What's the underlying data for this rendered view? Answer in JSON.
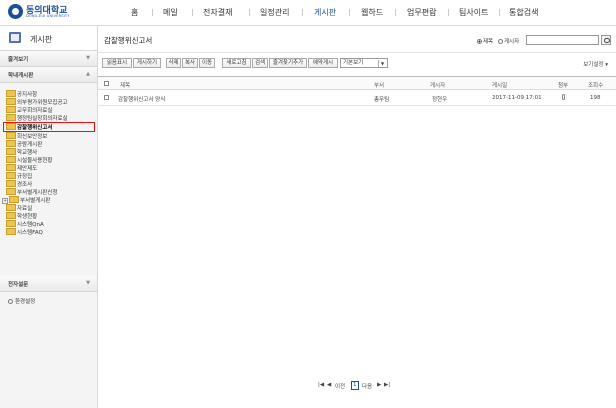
{
  "header": {
    "logo_name": "동의대학교",
    "logo_sub": "DONG-EUI UNIVERSITY",
    "nav": [
      "홈",
      "메일",
      "전자결재",
      "일정관리",
      "게시판",
      "웹하드",
      "업무편람",
      "팀사이트",
      "통합검색"
    ],
    "active_nav": "게시판"
  },
  "sidebar": {
    "title": "게시판",
    "sections": {
      "favorites": "즐겨보기",
      "campus_board": "학내게시판",
      "survey": "전자설문"
    },
    "tree": [
      {
        "label": "공지사항",
        "plus": false
      },
      {
        "label": "외부평가위원모집공고",
        "plus": false
      },
      {
        "label": "교무회의자료실",
        "plus": false
      },
      {
        "label": "행정팀실장회의자료실",
        "plus": false
      },
      {
        "label": "감찰행위신고서",
        "plus": false,
        "selected": true
      },
      {
        "label": "회신보안정보",
        "plus": false
      },
      {
        "label": "공람게시판",
        "plus": false
      },
      {
        "label": "학교행사",
        "plus": false
      },
      {
        "label": "시설물사용현황",
        "plus": false
      },
      {
        "label": "제안제도",
        "plus": false
      },
      {
        "label": "규정집",
        "plus": false
      },
      {
        "label": "경조사",
        "plus": false
      },
      {
        "label": "부서별게시판신청",
        "plus": false
      },
      {
        "label": "부서별게시판",
        "plus": true
      },
      {
        "label": "자료실",
        "plus": false
      },
      {
        "label": "학생현황",
        "plus": false
      },
      {
        "label": "시스템QnA",
        "plus": false
      },
      {
        "label": "시스템FAQ",
        "plus": false
      }
    ],
    "settings_label": "환경설정"
  },
  "main": {
    "title": "감찰행위신고서",
    "search": {
      "radio_title": "제목",
      "radio_author": "게시자",
      "selected": "제목",
      "value": "",
      "placeholder": ""
    },
    "toolbar": [
      "읽음표시",
      "게시하기",
      "삭제",
      "복사",
      "이동",
      "새로고침",
      "검색",
      "즐겨찾기추가",
      "예약게시"
    ],
    "view_select": "기본보기",
    "view_settings": "보기설정",
    "columns": {
      "title": "제목",
      "dept": "부서",
      "author": "게시자",
      "date": "게시일",
      "attach": "첨부",
      "views": "조회수"
    },
    "rows": [
      {
        "title": "감찰행위신고서 양식",
        "dept": "총무팀",
        "author": "정현우",
        "date": "2017-11-09 17:01",
        "views": "198"
      }
    ],
    "pager": {
      "first": "|◀",
      "prev_icon": "◀",
      "prev": "이전",
      "current": "1",
      "next": "다음",
      "next_icon": "▶",
      "last": "▶|"
    }
  },
  "colors": {
    "brand": "#1a4f9c",
    "highlight_border": "#ee1111",
    "folder": "#f0c44c"
  }
}
